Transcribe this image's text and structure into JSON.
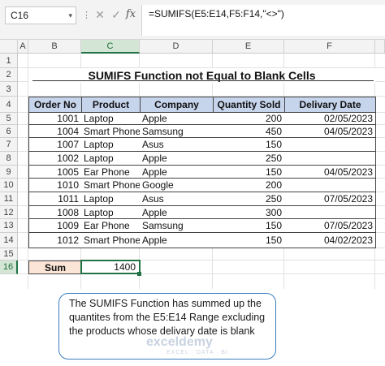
{
  "formula_bar": {
    "name_box": "C16",
    "name_box_arrow": "▾",
    "separator": "⋮",
    "cancel_icon": "✕",
    "enter_icon": "✓",
    "fx_label": "fx",
    "formula": "=SUMIFS(E5:E14,F5:F14,\"<>\")"
  },
  "grid": {
    "columns": [
      "A",
      "B",
      "C",
      "D",
      "E",
      "F"
    ],
    "rows": [
      "1",
      "2",
      "3",
      "4",
      "5",
      "6",
      "7",
      "8",
      "9",
      "10",
      "11",
      "12",
      "13",
      "14",
      "15",
      "16"
    ],
    "selected_column": "C",
    "selected_row": "16"
  },
  "title": "SUMIFS Function not Equal to Blank Cells",
  "table": {
    "headers": [
      "Order No",
      "Product",
      "Company",
      "Quantity Sold",
      "Delivary Date"
    ],
    "rows": [
      [
        "1001",
        "Laptop",
        "Apple",
        "200",
        "02/05/2023"
      ],
      [
        "1004",
        "Smart Phone",
        "Samsung",
        "450",
        "04/05/2023"
      ],
      [
        "1007",
        "Laptop",
        "Asus",
        "150",
        ""
      ],
      [
        "1002",
        "Laptop",
        "Apple",
        "250",
        ""
      ],
      [
        "1005",
        "Ear Phone",
        "Apple",
        "150",
        "04/05/2023"
      ],
      [
        "1010",
        "Smart Phone",
        "Google",
        "200",
        ""
      ],
      [
        "1011",
        "Laptop",
        "Asus",
        "250",
        "07/05/2023"
      ],
      [
        "1008",
        "Laptop",
        "Apple",
        "300",
        ""
      ],
      [
        "1009",
        "Ear Phone",
        "Samsung",
        "150",
        "07/05/2023"
      ],
      [
        "1012",
        "Smart Phone",
        "Apple",
        "150",
        "04/02/2023"
      ]
    ]
  },
  "sum": {
    "label": "Sum",
    "value": "1400"
  },
  "callout": "The SUMIFS Function has summed up the quantites from the E5:E14 Range excluding the products whose delivary date is blank",
  "watermark": {
    "name": "exceldemy",
    "tagline": "EXCEL · DATA · BI"
  },
  "colors": {
    "header_fill": "#c6d4ec",
    "sum_label_fill": "#fbe5d6",
    "selection": "#217346",
    "callout_border": "#3b7dbf"
  }
}
